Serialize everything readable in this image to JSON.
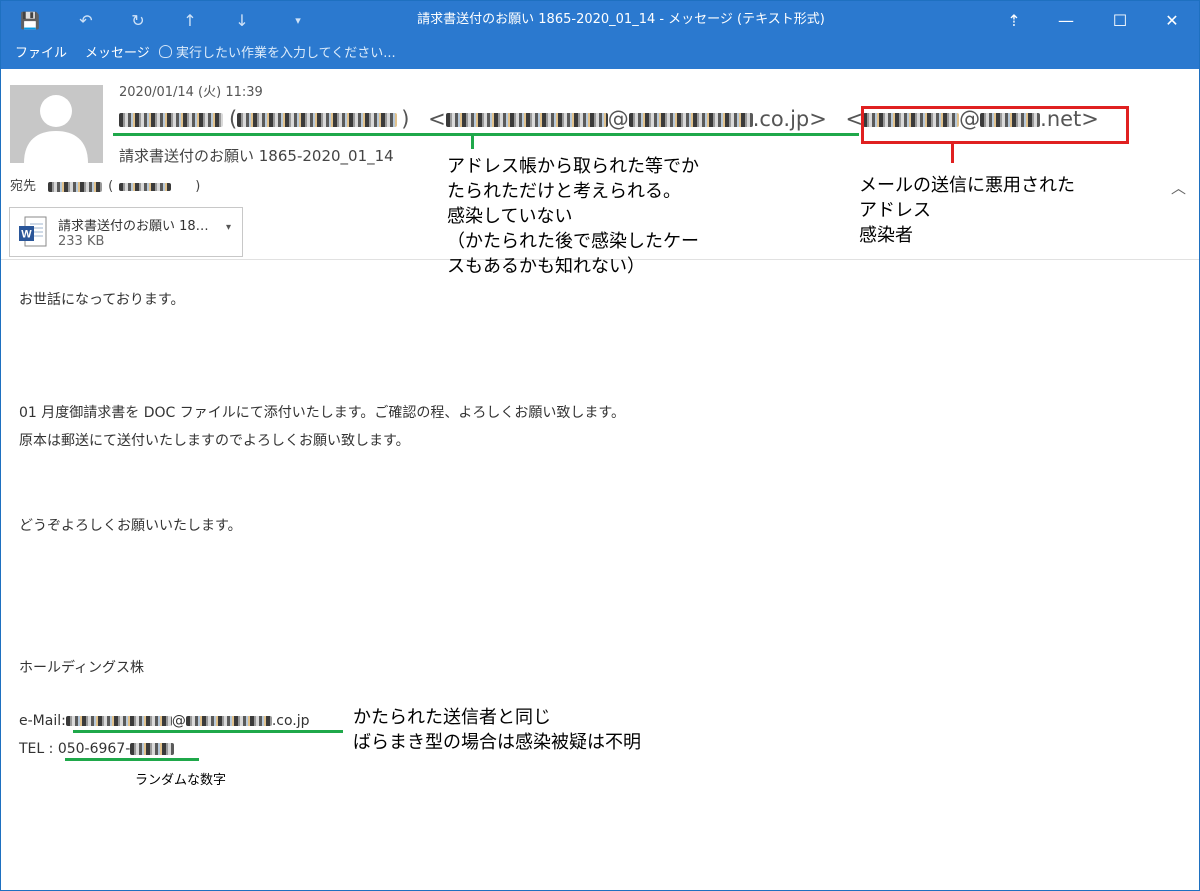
{
  "window": {
    "title": "請求書送付のお願い 1865-2020_01_14 - メッセージ (テキスト形式)",
    "accent": "#2b79cf"
  },
  "quick_access": [
    {
      "icon": "save-icon",
      "glyph": "💾"
    },
    {
      "icon": "undo-icon",
      "glyph": "↶"
    },
    {
      "icon": "redo-icon",
      "glyph": "↻"
    },
    {
      "icon": "arrow-up-icon",
      "glyph": "↑"
    },
    {
      "icon": "arrow-down-icon",
      "glyph": "↓"
    },
    {
      "icon": "customize-icon",
      "glyph": "▾"
    }
  ],
  "window_controls": {
    "restore_ribbon": "⇡",
    "minimize": "—",
    "maximize": "☐",
    "close": "✕"
  },
  "ribbon": {
    "tabs": [
      "ファイル",
      "メッセージ"
    ],
    "tell_me_icon": "lightbulb-icon",
    "tell_me": "実行したい作業を入力してください..."
  },
  "header": {
    "date": "2020/01/14 (火) 11:39",
    "from_open_paren": "(",
    "from_close_paren": ")",
    "from_lt": "<",
    "from_at": "@",
    "from_domain": ".co.jp>",
    "from_lt2": "<",
    "from_at2": "@",
    "from_domain2": ".net>",
    "subject": "請求書送付のお願い 1865-2020_01_14",
    "to_label": "宛先",
    "to_paren_open": "(",
    "to_paren_close": ")"
  },
  "attachment": {
    "icon": "word-document-icon",
    "name": "請求書送付のお願い 18…",
    "size": "233 KB"
  },
  "body": {
    "greeting": "お世話になっております。",
    "line1": "01 月度御請求書を DOC ファイルにて添付いたします。ご確認の程、よろしくお願い致します。",
    "line2": "原本は郵送にて送付いたしますのでよろしくお願い致します。",
    "closing": "どうぞよろしくお願いいたします。",
    "company": "ホールディングス株",
    "email_label": "e-Mail:",
    "email_at": "@",
    "email_domain": ".co.jp",
    "tel_label": "TEL : ",
    "tel_value": "050-6967-"
  },
  "annotations": {
    "sender_note": [
      "アドレス帳から取られた等でか",
      "たられただけと考えられる。",
      "感染していない",
      "（かたられた後で感染したケー",
      "スもあるかも知れない）"
    ],
    "infected_note": [
      "メールの送信に悪用された",
      "アドレス",
      "感染者"
    ],
    "sig_note": [
      "かたられた送信者と同じ",
      "ばらまき型の場合は感染被疑は不明"
    ],
    "random_note": "ランダムな数字",
    "green": "#1fa84a",
    "red": "#e02020"
  }
}
